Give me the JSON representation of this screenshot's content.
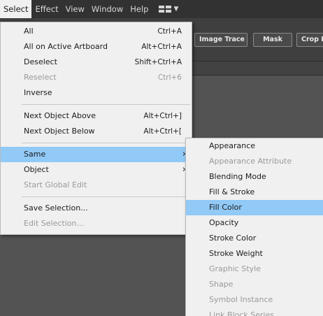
{
  "menubar": {
    "items": [
      "Select",
      "Effect",
      "View",
      "Window",
      "Help"
    ],
    "active_index": 0,
    "workspace_icon": "grid-icon"
  },
  "controlbar": {
    "image_trace": "Image Trace",
    "image_trace_arrow": "˅",
    "mask": "Mask",
    "crop": "Crop Image"
  },
  "select_menu": {
    "groups": [
      [
        {
          "label": "All",
          "shortcut": "Ctrl+A",
          "enabled": true
        },
        {
          "label": "All on Active Artboard",
          "shortcut": "Alt+Ctrl+A",
          "enabled": true
        },
        {
          "label": "Deselect",
          "shortcut": "Shift+Ctrl+A",
          "enabled": true
        },
        {
          "label": "Reselect",
          "shortcut": "Ctrl+6",
          "enabled": false
        },
        {
          "label": "Inverse",
          "shortcut": "",
          "enabled": true
        }
      ],
      [
        {
          "label": "Next Object Above",
          "shortcut": "Alt+Ctrl+]",
          "enabled": true
        },
        {
          "label": "Next Object Below",
          "shortcut": "Alt+Ctrl+[",
          "enabled": true
        }
      ],
      [
        {
          "label": "Same",
          "submenu": true,
          "enabled": true,
          "highlight": true
        },
        {
          "label": "Object",
          "submenu": true,
          "enabled": true
        },
        {
          "label": "Start Global Edit",
          "enabled": false
        }
      ],
      [
        {
          "label": "Save Selection...",
          "enabled": true
        },
        {
          "label": "Edit Selection...",
          "enabled": false
        }
      ]
    ]
  },
  "same_submenu": {
    "items": [
      {
        "label": "Appearance",
        "enabled": true
      },
      {
        "label": "Appearance Attribute",
        "enabled": false
      },
      {
        "label": "Blending Mode",
        "enabled": true
      },
      {
        "label": "Fill & Stroke",
        "enabled": true
      },
      {
        "label": "Fill Color",
        "enabled": true,
        "highlight": true
      },
      {
        "label": "Opacity",
        "enabled": true
      },
      {
        "label": "Stroke Color",
        "enabled": true
      },
      {
        "label": "Stroke Weight",
        "enabled": true
      },
      {
        "label": "Graphic Style",
        "enabled": false
      },
      {
        "label": "Shape",
        "enabled": false
      },
      {
        "label": "Symbol Instance",
        "enabled": false
      },
      {
        "label": "Link Block Series",
        "enabled": false
      }
    ]
  },
  "colors": {
    "highlight": "#91c9f7",
    "menu_bg": "#f0f0f0",
    "app_bg": "#535353"
  }
}
